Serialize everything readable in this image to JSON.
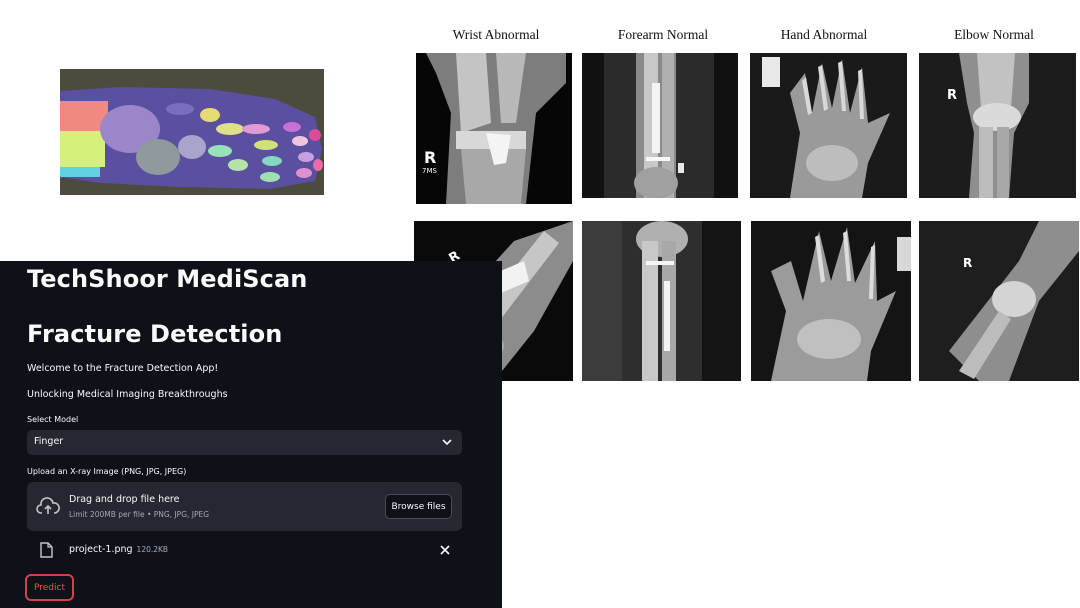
{
  "gallery": {
    "titles": [
      "Wrist Abnormal",
      "Forearm Normal",
      "Hand Abnormal",
      "Elbow Normal"
    ],
    "marker_labels": [
      "R",
      "7MS",
      "R",
      "R",
      "R"
    ]
  },
  "app": {
    "title_line1": "TechShoor MediScan",
    "title_line2": "Fracture Detection",
    "welcome": "Welcome to the Fracture Detection App!",
    "tagline": "Unlocking Medical Imaging Breakthroughs",
    "select_label": "Select Model",
    "select_value": "Finger",
    "upload_label": "Upload an X-ray Image (PNG, JPG, JPEG)",
    "dropzone_title": "Drag and drop file here",
    "dropzone_limit": "Limit 200MB per file • PNG, JPG, JPEG",
    "browse_label": "Browse files",
    "file_name": "project-1.png",
    "file_size": "120.2KB",
    "predict_label": "Predict"
  },
  "colors": {
    "app_background": "#0e1117",
    "widget_background": "#262730",
    "accent": "#ff4b4b"
  },
  "icons": [
    "chevron-down-icon",
    "cloud-upload-icon",
    "file-icon",
    "close-icon"
  ]
}
